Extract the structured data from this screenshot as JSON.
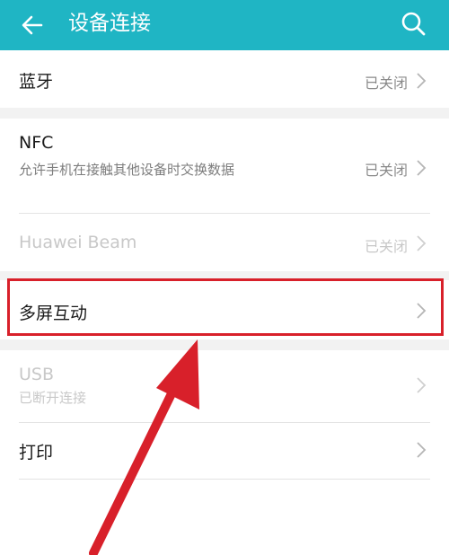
{
  "header": {
    "title": "设备连接",
    "background": "#1fb5c4"
  },
  "rows": {
    "bluetooth": {
      "label": "蓝牙",
      "status": "已关闭"
    },
    "nfc": {
      "label": "NFC",
      "description": "允许手机在接触其他设备时交换数据",
      "status": "已关闭"
    },
    "huawei_beam": {
      "label": "Huawei Beam",
      "status": "已关闭"
    },
    "multi_screen": {
      "label": "多屏互动"
    },
    "usb": {
      "label": "USB",
      "description": "已断开连接"
    },
    "print": {
      "label": "打印"
    }
  },
  "annotation": {
    "highlight_color": "#d8202a",
    "highlighted_item": "多屏互动"
  }
}
